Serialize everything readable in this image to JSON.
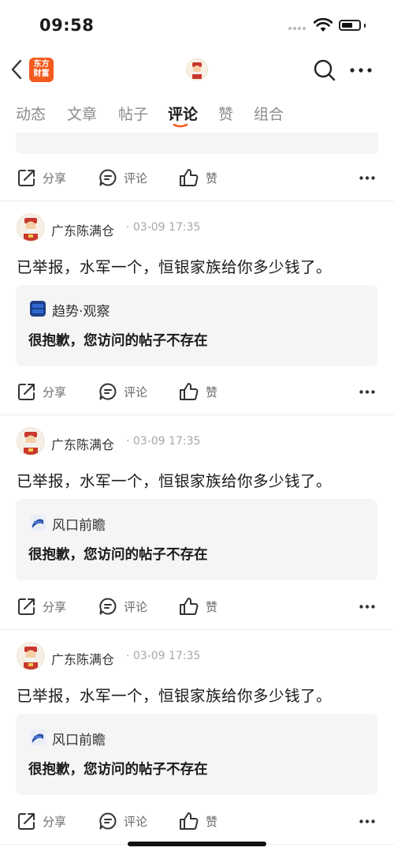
{
  "status_bar": {
    "time": "09:58"
  },
  "nav": {
    "logo_line1": "东方",
    "logo_line2": "财富"
  },
  "tabs": [
    "动态",
    "文章",
    "帖子",
    "评论",
    "赞",
    "组合"
  ],
  "active_tab": "评论",
  "actions": {
    "share": "分享",
    "comment": "评论",
    "like": "赞"
  },
  "posts": [
    {
      "author": "广东陈满仓",
      "time": "· 03-09 17:35",
      "text": "已举报，水军一个，恒银家族给你多少钱了。",
      "quote": {
        "source": "趋势·观察",
        "source_logo_text": "趋势观察",
        "message": "很抱歉，您访问的帖子不存在"
      }
    },
    {
      "author": "广东陈满仓",
      "time": "· 03-09 17:35",
      "text": "已举报，水军一个，恒银家族给你多少钱了。",
      "quote": {
        "source": "风口前瞻",
        "source_logo_text": "风口前瞻",
        "message": "很抱歉，您访问的帖子不存在"
      }
    },
    {
      "author": "广东陈满仓",
      "time": "· 03-09 17:35",
      "text": "已举报，水军一个，恒银家族给你多少钱了。",
      "quote": {
        "source": "风口前瞻",
        "source_logo_text": "风口前瞻",
        "message": "很抱歉，您访问的帖子不存在"
      }
    }
  ],
  "colors": {
    "accent": "#f25a1e",
    "muted": "#8c8c8c",
    "card_bg": "#f5f5f6"
  }
}
